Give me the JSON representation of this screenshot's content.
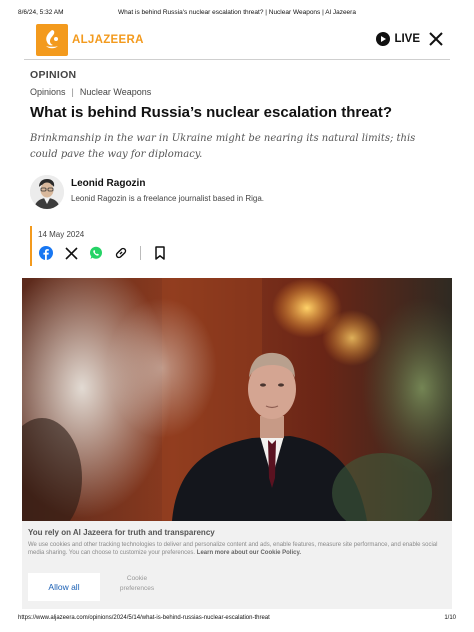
{
  "print_header": {
    "datetime": "8/6/24, 5:32 AM",
    "title": "What is behind Russia's nuclear escalation threat? | Nuclear Weapons | Al Jazeera"
  },
  "site": {
    "brand": "ALJAZEERA",
    "brand_color": "#f39a1d",
    "live_label": "LIVE"
  },
  "article": {
    "section": "OPINION",
    "breadcrumbs": [
      "Opinions",
      "Nuclear Weapons"
    ],
    "headline": "What is behind Russia’s nuclear escalation threat?",
    "standfirst": "Brinkmanship in the war in Ukraine might be nearing its natural limits; this could pave the way for diplomacy.",
    "author": {
      "name": "Leonid Ragozin",
      "bio": "Leonid Ragozin is a freelance journalist based in Riga."
    },
    "date": "14 May 2024",
    "share_icons": [
      "facebook-icon",
      "x-icon",
      "whatsapp-icon",
      "link-icon",
      "bookmark-icon"
    ]
  },
  "cookie_banner": {
    "title": "You rely on Al Jazeera for truth and transparency",
    "text": "We use cookies and other tracking technologies to deliver and personalize content and ads, enable features, measure site performance, and enable social media sharing. You can choose to customize your preferences.",
    "link": "Learn more about our Cookie Policy.",
    "allow_label": "Allow all",
    "prefs_label_1": "Cookie",
    "prefs_label_2": "preferences"
  },
  "print_footer": {
    "url": "https://www.aljazeera.com/opinions/2024/5/14/what-is-behind-russias-nuclear-escalation-threat",
    "page": "1/10"
  }
}
